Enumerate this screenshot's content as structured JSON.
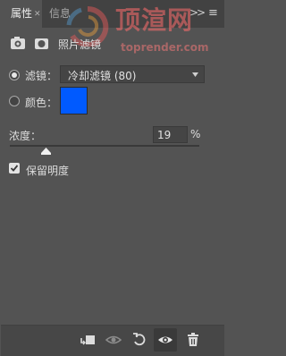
{
  "tabs": {
    "properties": "属性",
    "info": "信息"
  },
  "subhead": {
    "title": "照片滤镜",
    "icons": [
      "adjustment-layer-icon",
      "mask-icon"
    ]
  },
  "filter": {
    "label": "滤镜：",
    "value": "冷却滤镜 (80)",
    "selected": true
  },
  "color": {
    "label": "颜色：",
    "swatch": "#005aff",
    "selected": false
  },
  "density": {
    "label": "浓度：",
    "value": "19",
    "unit": "%",
    "fraction": 0.19
  },
  "preserve": {
    "label": "保留明度",
    "checked": true
  },
  "watermark": {
    "chinese": "顶渲网",
    "url": "toprender.com"
  },
  "footer_icons": [
    "clip-to-layer-icon",
    "view-previous-icon",
    "reset-icon",
    "visibility-icon",
    "delete-icon"
  ],
  "colors": {
    "panel": "#535353",
    "tabbar": "#424242",
    "swatch": "#005aff"
  }
}
